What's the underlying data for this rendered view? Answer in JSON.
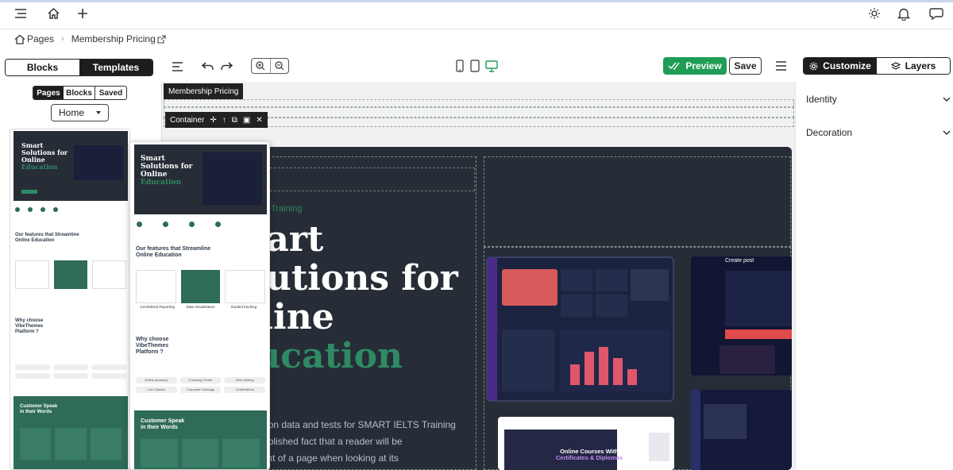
{
  "topbar": {
    "icons": [
      "menu-icon",
      "home-icon",
      "plus-icon",
      "sun-icon",
      "bell-icon",
      "chat-icon"
    ]
  },
  "breadcrumb": {
    "root": "Pages",
    "current": "Membership Pricing"
  },
  "toolbar": {
    "tab_blocks": "Blocks",
    "tab_templates": "Templates",
    "preview_label": "Preview",
    "save_label": "Save",
    "customize_label": "Customize",
    "layers_label": "Layers"
  },
  "left": {
    "subtabs": [
      "Pages",
      "Blocks",
      "Saved"
    ],
    "select_value": "Home",
    "template": {
      "hero_title_1": "Smart",
      "hero_title_2": "Solutions for",
      "hero_title_3": "Online",
      "hero_accent": "Education",
      "features_title_1": "Our features that Streamline",
      "features_title_2": "Online Education",
      "feature_labels": [
        "Centralized Reporting",
        "Data Visualization",
        "Student tracking"
      ],
      "why_title_1": "Why choose VibeThemes",
      "why_title_2": "Platform ?",
      "why_tags": [
        "Online Academy",
        "Coaching Center",
        "Web Hosting",
        "Live Classes",
        "Corporate Trainings",
        "Certifications"
      ],
      "customer_title_1": "Customer Speak",
      "customer_title_2": "in their Words"
    }
  },
  "canvas": {
    "page_tag": "Membership Pricing",
    "container_label": "Container",
    "hero_eyebrow": "Training",
    "hero_line1": "Smart",
    "hero_line2": "Solutions for",
    "hero_line3": "Online",
    "hero_line4": "Education",
    "para1": "Access education data and tests for SMART IELTS Training",
    "para2": "It is a long established fact that a reader will be",
    "para3": "readable content of a page when looking at its",
    "mock_title": "Online Courses With",
    "mock_title2": "Certificates & Diplomas",
    "create_post": "Create post"
  },
  "right": {
    "sections": [
      "Identity",
      "Decoration"
    ]
  },
  "colors": {
    "accent": "#1f9d55",
    "dark": "#272d36",
    "green": "#2e6b58",
    "hero_accent": "#2f8a64"
  }
}
